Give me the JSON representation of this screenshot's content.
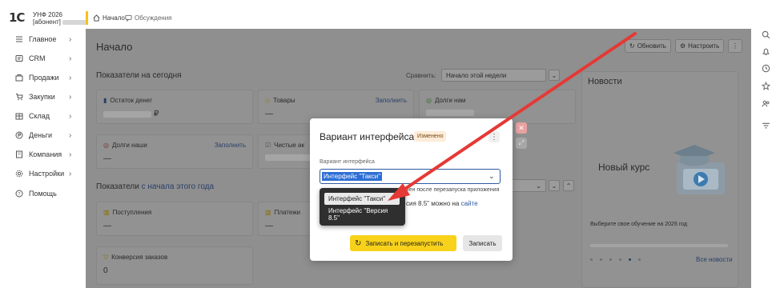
{
  "app": {
    "logo": "1С",
    "product": "УНФ 2026",
    "subscriber_label": "[абонент]"
  },
  "tabs": [
    {
      "label": "Начало",
      "icon": "home-icon",
      "active": true
    },
    {
      "label": "Обсуждения",
      "icon": "chat-icon",
      "active": false
    }
  ],
  "sidebar": {
    "items": [
      {
        "label": "Главное",
        "icon": "menu-icon",
        "chevron": "›"
      },
      {
        "label": "CRM",
        "icon": "crm-icon",
        "chevron": "›"
      },
      {
        "label": "Продажи",
        "icon": "sales-icon",
        "chevron": "›"
      },
      {
        "label": "Закупки",
        "icon": "cart-icon",
        "chevron": "›"
      },
      {
        "label": "Склад",
        "icon": "warehouse-icon",
        "chevron": "›"
      },
      {
        "label": "Деньги",
        "icon": "money-icon",
        "chevron": "›"
      },
      {
        "label": "Компания",
        "icon": "company-icon",
        "chevron": "›"
      },
      {
        "label": "Настройки",
        "icon": "gear-icon",
        "chevron": "›"
      },
      {
        "label": "Помощь",
        "icon": "help-icon",
        "chevron": ""
      }
    ]
  },
  "rail": [
    "search-icon",
    "bell-icon",
    "history-icon",
    "star-icon",
    "users-icon",
    "filter-icon"
  ],
  "page": {
    "title": "Начало",
    "refresh_label": "Обновить",
    "customize_label": "Настроить",
    "kebab": "⋮"
  },
  "today": {
    "title": "Показатели на сегодня",
    "compare_label": "Сравнить:",
    "compare_value": "Начало этой недели",
    "cards": [
      {
        "title": "Остаток денег",
        "value": "₽",
        "fill": ""
      },
      {
        "title": "Товары",
        "value": "—",
        "fill": "Заполнить"
      },
      {
        "title": "Долги нам",
        "value": "",
        "fill": ""
      },
      {
        "title": "Долги наши",
        "value": "—",
        "fill": "Заполнить"
      },
      {
        "title": "Чистые ак",
        "value": "",
        "fill": ""
      }
    ]
  },
  "period": {
    "title": "Показатели",
    "link": "с начала этого года",
    "cards": [
      {
        "title": "Поступления",
        "value": "—"
      },
      {
        "title": "Платежи",
        "value": "—"
      },
      {
        "title": "Конверсия заказов",
        "value": "0"
      }
    ]
  },
  "news": {
    "title": "Новости",
    "course": "Новый курс",
    "course_desc": "Выберите свое обучение на 2026 год",
    "all_link": "Все новости"
  },
  "dialog": {
    "title": "Вариант интерфейса",
    "badge": "Изменено",
    "field_label": "Вариант интерфейса",
    "field_value": "Интерфейс \"Такси\"",
    "note_restart": "чен после перезапуска приложения",
    "note_version_prefix": "сия 8.5\" можно на ",
    "note_version_link": "сайте",
    "btn_save_restart": "Записать и перезапустить",
    "btn_save": "Записать",
    "options": [
      "Интерфейс \"Такси\"",
      "Интерфейс \"Версия 8.5\""
    ]
  },
  "colors": {
    "accent_yellow": "#f8d21a",
    "selection_blue": "#2c6ed5",
    "arrow_red": "#e53935",
    "badge_bg": "#fdecd7"
  }
}
